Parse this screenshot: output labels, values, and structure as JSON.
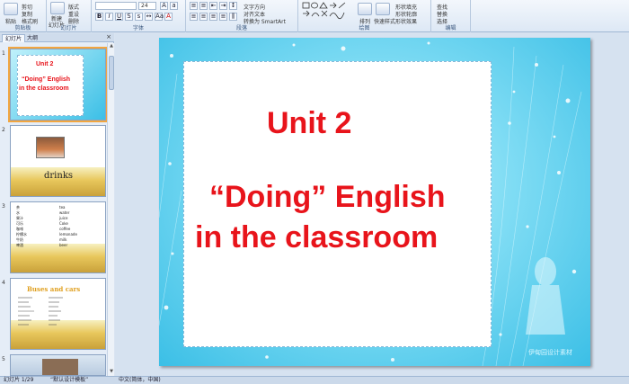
{
  "ribbon": {
    "clipboard": {
      "paste": "粘贴",
      "cut": "剪切",
      "copy": "复制",
      "format_painter": "格式刷",
      "label": "剪贴板"
    },
    "slides": {
      "new_slide": "新建",
      "new_slide2": "幻灯片",
      "layout": "版式",
      "reset": "重设",
      "delete": "删除",
      "label": "幻灯片"
    },
    "font": {
      "font_name": "",
      "font_size": "24",
      "label": "字体"
    },
    "paragraph": {
      "text_direction": "文字方向",
      "align_text": "对齐文本",
      "smartart": "转换为 SmartArt",
      "label": "段落"
    },
    "drawing": {
      "arrange": "排列",
      "quick_styles": "快速样式",
      "shape_fill": "形状填充",
      "shape_outline": "形状轮廓",
      "shape_effects": "形状效果",
      "label": "绘图"
    },
    "editing": {
      "find": "查找",
      "replace": "替换",
      "select": "选择",
      "label": "编辑"
    }
  },
  "panel": {
    "tab_slides": "幻灯片",
    "tab_outline": "大纲",
    "close": "×",
    "slides": [
      {
        "num": "1",
        "line1": "Unit 2",
        "line2": "“Doing” English",
        "line3": "in the classroom"
      },
      {
        "num": "2",
        "caption": "drinks"
      },
      {
        "num": "3",
        "rows": [
          [
            "茶",
            "tea"
          ],
          [
            "水",
            "water"
          ],
          [
            "果汁",
            "juice"
          ],
          [
            "可乐",
            "Coke"
          ],
          [
            "咖啡",
            "coffee"
          ],
          [
            "柠檬水",
            "lemonade"
          ],
          [
            "牛奶",
            "milk"
          ],
          [
            "啤酒",
            "beer"
          ]
        ]
      },
      {
        "num": "4",
        "title": "Buses and cars"
      },
      {
        "num": "5"
      }
    ]
  },
  "slide": {
    "line1": "Unit 2",
    "line2": "“Doing”  English",
    "line3": "in the classroom",
    "watermark": "伊甸园设计素材"
  },
  "status": {
    "slide_count": "幻灯片 1/29",
    "theme": "“默认设计模板”",
    "language": "中文(简体，中国)"
  }
}
